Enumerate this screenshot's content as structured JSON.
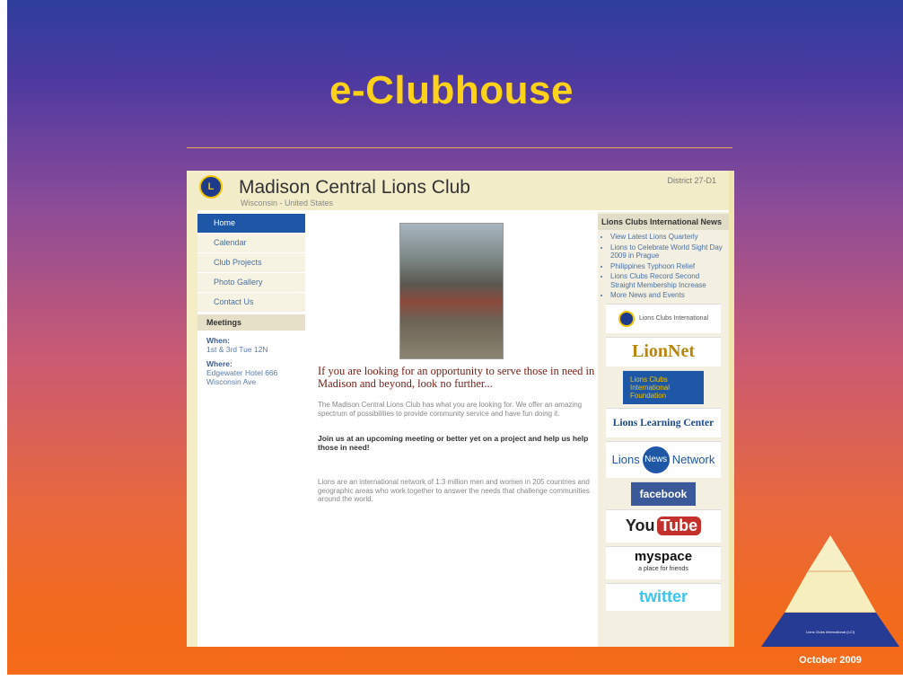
{
  "slide": {
    "title": "e-Clubhouse",
    "footer_date": "October 2009",
    "pyramid_label": "Lions Clubs International (LCI)"
  },
  "site": {
    "title": "Madison Central Lions Club",
    "subtitle": "Wisconsin - United States",
    "district": "District 27-D1",
    "nav": [
      {
        "label": "Home",
        "active": true
      },
      {
        "label": "Calendar",
        "active": false
      },
      {
        "label": "Club Projects",
        "active": false
      },
      {
        "label": "Photo Gallery",
        "active": false
      },
      {
        "label": "Contact Us",
        "active": false
      }
    ],
    "meetings": {
      "heading": "Meetings",
      "when_label": "When:",
      "when_value": "1st & 3rd Tue 12N",
      "where_label": "Where:",
      "where_value": "Edgewater Hotel 666 Wisconsin Ave"
    },
    "main": {
      "headline": "If you are looking for an opportunity to serve those in need in Madison and beyond, look no further...",
      "para1": "The Madison Central Lions Club has what you are looking for. We offer an amazing spectrum of possibilities to provide community service and have fun doing it.",
      "bold": "Join us at an upcoming meeting or better yet on a project and help us help those in need!",
      "para2": "Lions are an international network of 1.3 million men and women in 205 countries and geographic areas who work together to answer the needs that challenge communities around the world."
    },
    "news": {
      "heading": "Lions Clubs International News",
      "items": [
        "View Latest Lions Quarterly",
        "Lions to Celebrate World Sight Day 2009 in Prague",
        "Philippines Typhoon Relief",
        "Lions Clubs Record Second Straight Membership Increase",
        "More News and Events"
      ]
    },
    "badges": {
      "lci": "Lions Clubs International",
      "lionnet": "LionNet",
      "lcif": "Lions Clubs International Foundation",
      "llc": "Lions Learning Center",
      "lnn_left": "Lions",
      "lnn_mid": "News",
      "lnn_right": "Network",
      "facebook": "facebook",
      "youtube_you": "You",
      "youtube_tube": "Tube",
      "myspace": "myspace",
      "myspace_sub": "a place for friends",
      "twitter": "twitter"
    }
  },
  "colors": {
    "title": "#ffd21a",
    "nav_active": "#1e57a6",
    "headline": "#7a2018"
  }
}
